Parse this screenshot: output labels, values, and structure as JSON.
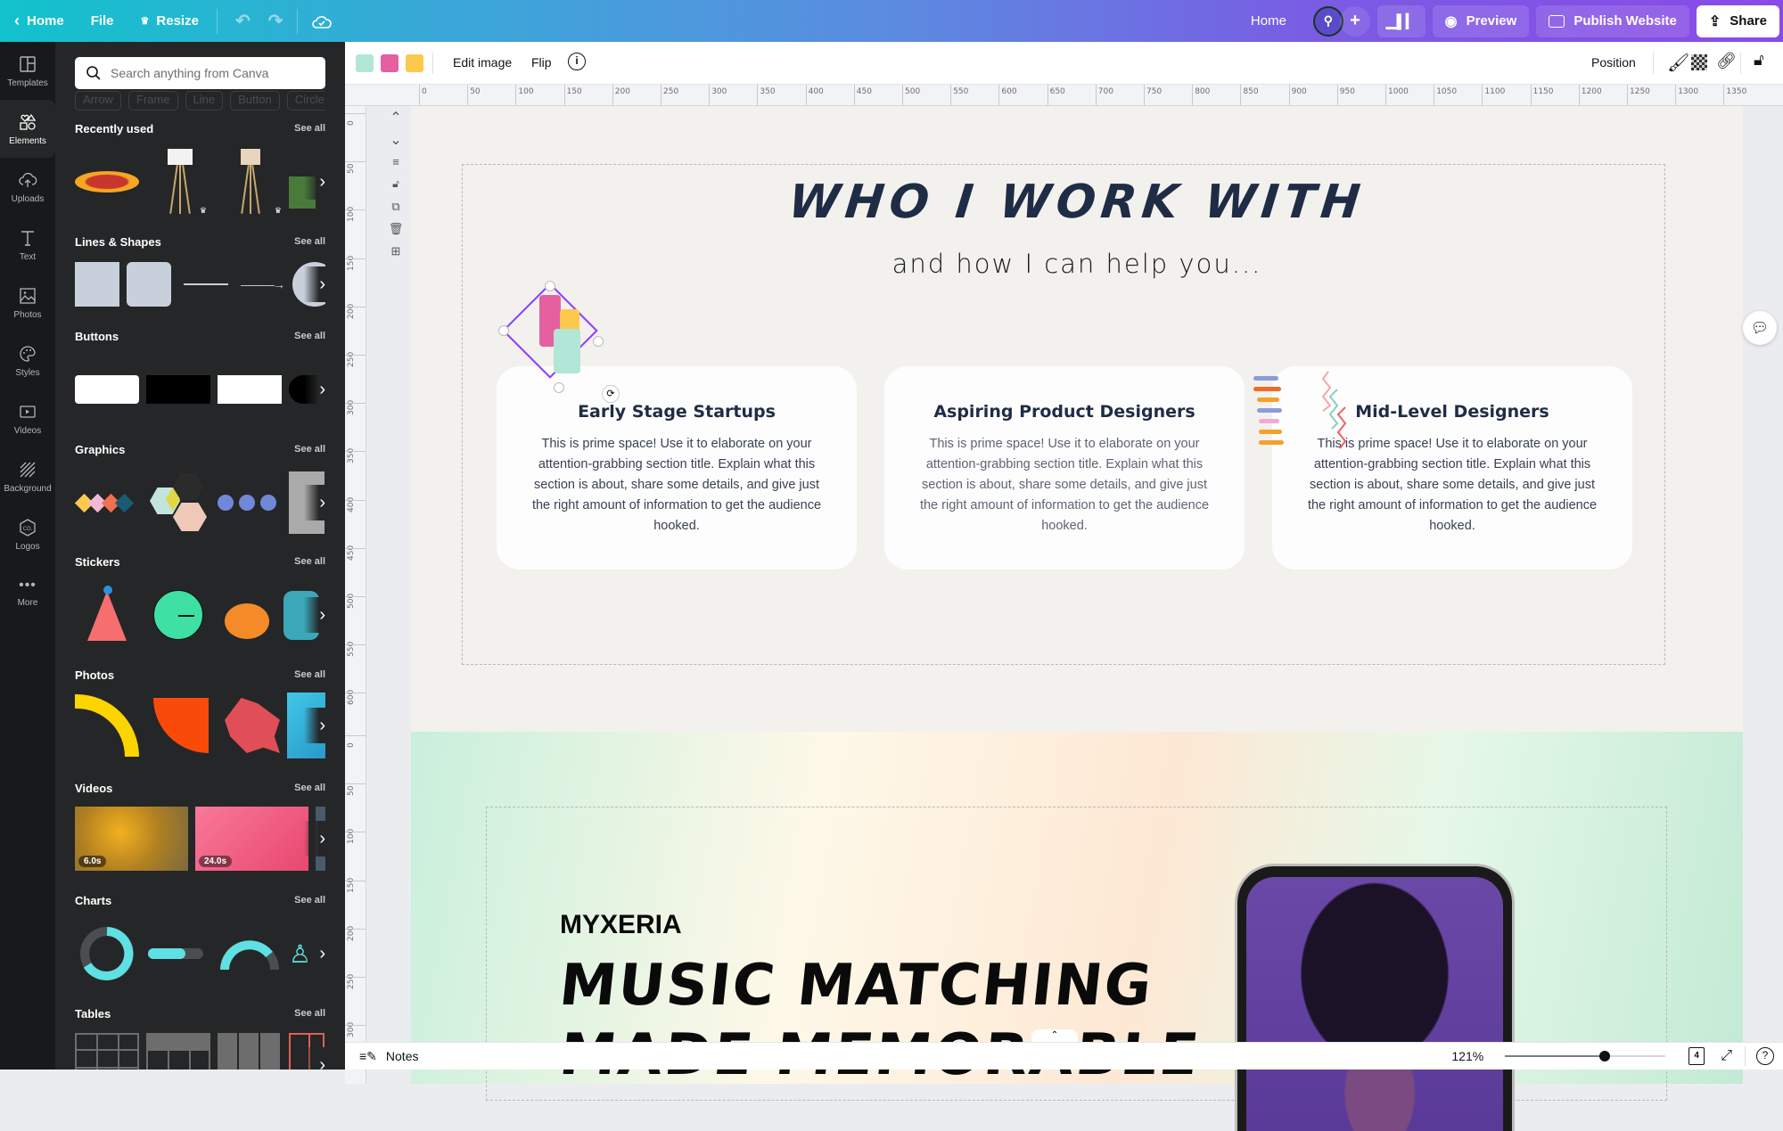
{
  "topbar": {
    "home_label": "Home",
    "file_label": "File",
    "resize_label": "Resize",
    "home_right_label": "Home",
    "preview_label": "Preview",
    "publish_label": "Publish Website",
    "share_label": "Share"
  },
  "rail": {
    "items": [
      {
        "label": "Templates",
        "icon": "templates-icon"
      },
      {
        "label": "Elements",
        "icon": "elements-icon",
        "active": true
      },
      {
        "label": "Uploads",
        "icon": "upload-cloud-icon"
      },
      {
        "label": "Text",
        "icon": "text-icon"
      },
      {
        "label": "Photos",
        "icon": "photo-icon"
      },
      {
        "label": "Styles",
        "icon": "palette-icon"
      },
      {
        "label": "Videos",
        "icon": "video-icon"
      },
      {
        "label": "Background",
        "icon": "background-icon"
      },
      {
        "label": "Logos",
        "icon": "logo-icon"
      },
      {
        "label": "More",
        "icon": "more-icon"
      }
    ]
  },
  "panel": {
    "search_placeholder": "Search anything from Canva",
    "chips": [
      "Arrow",
      "Frame",
      "Line",
      "Button",
      "Circle"
    ],
    "sections": [
      {
        "title": "Recently used",
        "see_all": "See all"
      },
      {
        "title": "Lines & Shapes",
        "see_all": "See all"
      },
      {
        "title": "Buttons",
        "see_all": "See all"
      },
      {
        "title": "Graphics",
        "see_all": "See all"
      },
      {
        "title": "Stickers",
        "see_all": "See all"
      },
      {
        "title": "Photos",
        "see_all": "See all"
      },
      {
        "title": "Videos",
        "see_all": "See all"
      },
      {
        "title": "Charts",
        "see_all": "See all"
      },
      {
        "title": "Tables",
        "see_all": "See all"
      }
    ],
    "video_durations": [
      "6.0s",
      "24.0s"
    ]
  },
  "context_toolbar": {
    "swatches": [
      "#b2e6d6",
      "#e460a0",
      "#fcc94d"
    ],
    "edit_image_label": "Edit image",
    "flip_label": "Flip",
    "position_label": "Position"
  },
  "ruler": {
    "horizontal": [
      "0",
      "50",
      "100",
      "150",
      "200",
      "250",
      "300",
      "350",
      "400",
      "450",
      "500",
      "550",
      "600",
      "650",
      "700",
      "750",
      "800",
      "850",
      "900",
      "950",
      "1000",
      "1050",
      "1100",
      "1150",
      "1200",
      "1250",
      "1300",
      "1350"
    ],
    "vertical_page1": [
      "0",
      "50",
      "100",
      "150",
      "200",
      "250",
      "300",
      "350",
      "400",
      "450",
      "500",
      "550",
      "600"
    ],
    "vertical_page2": [
      "0",
      "50",
      "100",
      "150",
      "200",
      "250",
      "300"
    ]
  },
  "page1": {
    "heading": "WHO I WORK WITH",
    "subheading": "and how I can help you...",
    "cards": [
      {
        "title": "Early Stage Startups",
        "body": "This is prime space! Use it to elaborate on your attention-grabbing section title. Explain what this section is about, share some details, and give just the right amount of information to get the audience hooked."
      },
      {
        "title": "Aspiring Product Designers",
        "body": "This is prime space! Use it to elaborate on your attention-grabbing section title. Explain what this section is about, share some details, and give just the right amount of information to get the audience hooked."
      },
      {
        "title": "Mid-Level Designers",
        "body": "This is prime space! Use it to elaborate on your attention-grabbing section title. Explain what this section is about, share some details, and give just the right amount of information to get the audience hooked."
      }
    ]
  },
  "page2": {
    "brand": "MYXERIA",
    "headline_line1": "MUSIC MATCHING",
    "headline_line2": "MADE MEMORABLE"
  },
  "footer": {
    "notes_label": "Notes",
    "zoom_label": "121%",
    "zoom_fraction": 0.62,
    "page_count": "4"
  }
}
